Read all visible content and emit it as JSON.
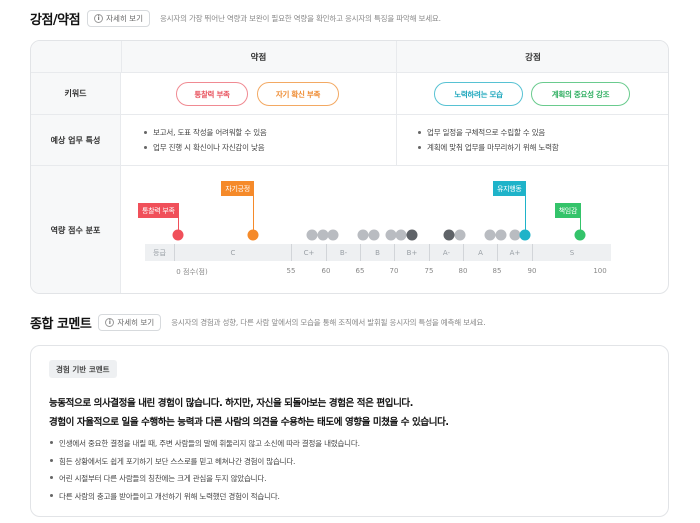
{
  "strengths_weaknesses": {
    "title": "강점/약점",
    "detail_label": "자세히 보기",
    "description": "응시자의 가장 뛰어난 역량과 보완이 필요한 역량을 확인하고 응시자의 특징을 파악해 보세요.",
    "col_weak": "약점",
    "col_strong": "강점",
    "row_keywords": "키워드",
    "row_tasks": "예상 업무 특성",
    "row_distribution": "역량 점수 분포",
    "weak_keywords": [
      "통찰력 부족",
      "자기 확신 부족"
    ],
    "strong_keywords": [
      "노력하려는 모습",
      "계획의 중요성 강조"
    ],
    "weak_tasks": [
      "보고서, 도표 작성을 어려워할 수 있음",
      "업무 진행 시 확신이나 자신감이 낮음"
    ],
    "strong_tasks": [
      "업무 일정을 구체적으로 수립할 수 있음",
      "계획에 맞춰 업무를 마무리하기 위해 노력함"
    ]
  },
  "distribution": {
    "grades": [
      "등급",
      "C",
      "C+",
      "B-",
      "B",
      "B+",
      "A-",
      "A",
      "A+",
      "S"
    ],
    "ticks": [
      "0 점수(점)",
      "55",
      "60",
      "65",
      "70",
      "75",
      "80",
      "85",
      "90",
      "100"
    ],
    "flags": [
      {
        "label": "통찰력 부족",
        "score": 37,
        "color": "#f0505a"
      },
      {
        "label": "자기긍정",
        "score": 50,
        "color": "#f58a2a"
      },
      {
        "label": "유지행동",
        "score": 89,
        "color": "#1fb3c9"
      },
      {
        "label": "책임감",
        "score": 97,
        "color": "#34c36a"
      }
    ],
    "other_scores": [
      58,
      59.5,
      61,
      65.5,
      67,
      69.5,
      71,
      72.5,
      78,
      79.5,
      84,
      85.5,
      87.5
    ],
    "colors": {
      "gray": "#b9bcc1",
      "dark": "#5f6368"
    }
  },
  "comprehensive": {
    "title": "종합 코멘트",
    "detail_label": "자세히 보기",
    "description": "응시자의 경험과 성향, 다른 사람 앞에서의 모습을 통해 조직에서 발휘될 응시자의 특성을 예측해 보세요.",
    "badge": "경험 기반 코멘트",
    "headline_1": "능동적으로 의사결정을 내린 경험이 많습니다. 하지만, 자신을 되돌아보는 경험은 적은 편입니다.",
    "headline_2": "경험이 자율적으로 일을 수행하는 능력과 다른 사람의 의견을 수용하는 태도에 영향을 미쳤을 수 있습니다.",
    "bullets": [
      "인생에서 중요한 결정을 내릴 때, 주변 사람들의 말에 휘둘리지 않고 소신에 따라 결정을 내렸습니다.",
      "힘든 상황에서도 쉽게 포기하기 보단 스스로를 믿고 헤쳐나간 경험이 많습니다.",
      "어린 시절부터 다른 사람들의 칭찬에는 크게 관심을 두지 않았습니다.",
      "다른 사람의 충고를 받아들이고 개선하기 위해 노력했던 경험이 적습니다."
    ]
  }
}
